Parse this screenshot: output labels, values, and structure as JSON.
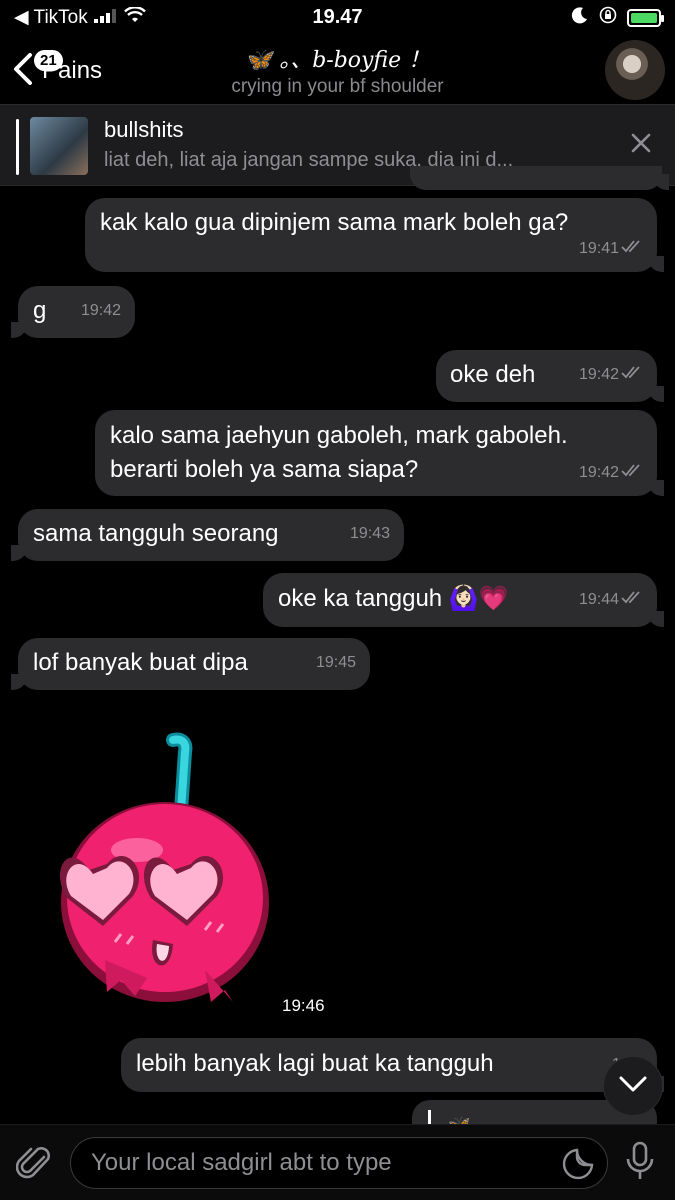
{
  "status": {
    "back_app": "◀ TikTok",
    "time": "19.47"
  },
  "header": {
    "back_badge": "21",
    "back_label": "Pains",
    "title": "🦋 。、b-boyfie ！",
    "subtitle": "crying in your bf shoulder"
  },
  "pinned": {
    "title": "bullshits",
    "text": "liat deh, liat aja jangan sampe suka. dia ini d..."
  },
  "messages": [
    {
      "id": "m1",
      "dir": "out",
      "text": "kak kalo gua dipinjem sama mark boleh ga?",
      "time": "19:41"
    },
    {
      "id": "m2",
      "dir": "in",
      "text": "g",
      "time": "19:42"
    },
    {
      "id": "m3",
      "dir": "out",
      "text": "oke deh",
      "time": "19:42"
    },
    {
      "id": "m4",
      "dir": "out",
      "text": "kalo sama jaehyun gaboleh, mark gaboleh.\nberarti boleh ya sama siapa?",
      "time": "19:42"
    },
    {
      "id": "m5",
      "dir": "in",
      "text": "sama tangguh seorang",
      "time": "19:43"
    },
    {
      "id": "m6",
      "dir": "out",
      "text": "oke ka tangguh 🙆🏻‍♀️💗",
      "time": "19:44"
    },
    {
      "id": "m7",
      "dir": "in",
      "text": "lof banyak buat dipa",
      "time": "19:45"
    },
    {
      "id": "m8",
      "dir": "out",
      "text": "lebih banyak lagi buat ka tangguh",
      "time": "19:4"
    }
  ],
  "sticker": {
    "time": "19:46",
    "icon": "cherry-heart-eyes-sticker"
  },
  "composer": {
    "placeholder": "Your local sadgirl abt to type"
  },
  "colors": {
    "bubble": "#2c2c2e",
    "background": "#000000",
    "meta": "#8e8e93"
  }
}
